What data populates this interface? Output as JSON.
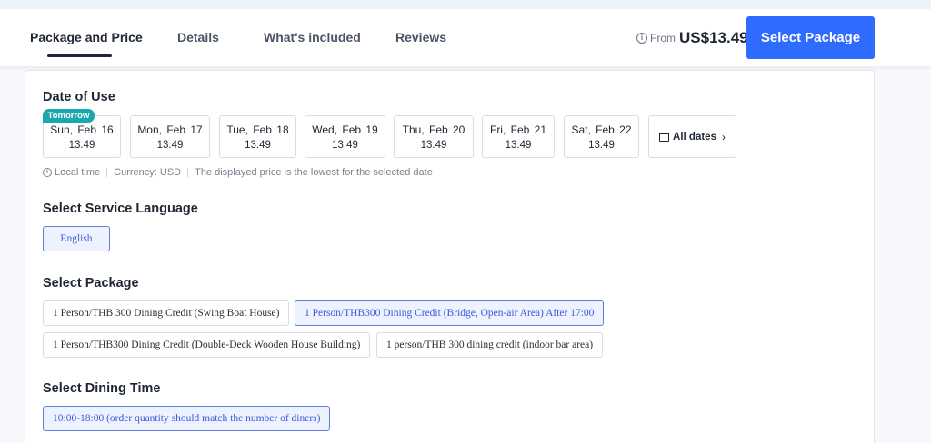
{
  "nav": {
    "tabs": [
      {
        "label": "Package and Price",
        "active": true
      },
      {
        "label": "Details"
      },
      {
        "label": "What's included"
      },
      {
        "label": "Reviews"
      }
    ],
    "from_label": "From",
    "price": "US$13.49",
    "select_button": "Select Package"
  },
  "date_section": {
    "title": "Date of Use",
    "badge": "Tomorrow",
    "dates": [
      {
        "day": "Sun, Feb 16",
        "price": "13.49"
      },
      {
        "day": "Mon, Feb 17",
        "price": "13.49"
      },
      {
        "day": "Tue, Feb 18",
        "price": "13.49"
      },
      {
        "day": "Wed, Feb 19",
        "price": "13.49"
      },
      {
        "day": "Thu, Feb 20",
        "price": "13.49"
      },
      {
        "day": "Fri, Feb 21",
        "price": "13.49"
      },
      {
        "day": "Sat, Feb 22",
        "price": "13.49"
      }
    ],
    "all_dates": "All dates",
    "meta": {
      "local_time": "Local time",
      "currency": "Currency: USD",
      "note": "The displayed price is the lowest for the selected date"
    }
  },
  "language_section": {
    "title": "Select Service Language",
    "options": [
      "English"
    ]
  },
  "package_section": {
    "title": "Select Package",
    "options": [
      "1 Person/THB 300 Dining Credit (Swing Boat House)",
      "1 Person/THB300 Dining Credit (Bridge, Open-air Area) After 17:00",
      "1 Person/THB300 Dining Credit (Double-Deck Wooden House Building)",
      "1 person/THB 300 dining credit (indoor bar area)"
    ]
  },
  "time_section": {
    "title": "Select Dining Time",
    "options": [
      "10:00-18:00 (order quantity should match the number of diners)"
    ]
  },
  "colors": {
    "accent": "#2f6bff",
    "badge": "#1aa7ad",
    "selected_border": "#5f7fe0",
    "selected_bg": "#eef2ff"
  },
  "icons": [
    "info-icon",
    "calendar-icon",
    "chevron-right-icon"
  ]
}
